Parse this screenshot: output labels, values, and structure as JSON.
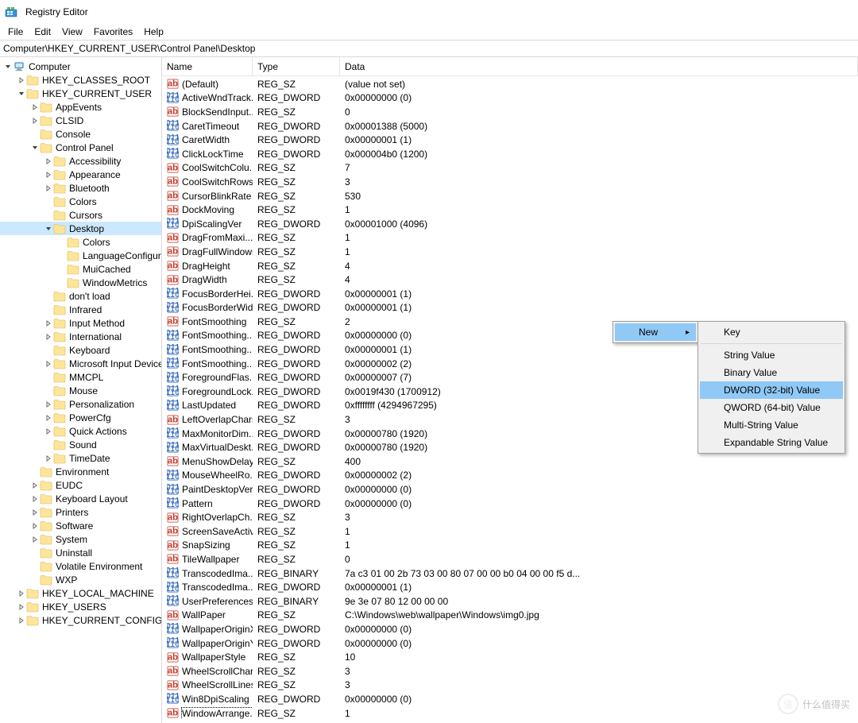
{
  "window": {
    "title": "Registry Editor"
  },
  "menu": {
    "file": "File",
    "edit": "Edit",
    "view": "View",
    "favorites": "Favorites",
    "help": "Help"
  },
  "address": {
    "path": "Computer\\HKEY_CURRENT_USER\\Control Panel\\Desktop"
  },
  "tree": [
    {
      "depth": 0,
      "exp": "open",
      "icon": "pc",
      "label": "Computer"
    },
    {
      "depth": 1,
      "exp": "closed",
      "icon": "folder",
      "label": "HKEY_CLASSES_ROOT"
    },
    {
      "depth": 1,
      "exp": "open",
      "icon": "folder",
      "label": "HKEY_CURRENT_USER"
    },
    {
      "depth": 2,
      "exp": "closed",
      "icon": "folder",
      "label": "AppEvents"
    },
    {
      "depth": 2,
      "exp": "closed",
      "icon": "folder",
      "label": "CLSID"
    },
    {
      "depth": 2,
      "exp": "none",
      "icon": "folder",
      "label": "Console"
    },
    {
      "depth": 2,
      "exp": "open",
      "icon": "folder",
      "label": "Control Panel"
    },
    {
      "depth": 3,
      "exp": "closed",
      "icon": "folder",
      "label": "Accessibility"
    },
    {
      "depth": 3,
      "exp": "closed",
      "icon": "folder",
      "label": "Appearance"
    },
    {
      "depth": 3,
      "exp": "closed",
      "icon": "folder",
      "label": "Bluetooth"
    },
    {
      "depth": 3,
      "exp": "none",
      "icon": "folder",
      "label": "Colors"
    },
    {
      "depth": 3,
      "exp": "none",
      "icon": "folder",
      "label": "Cursors"
    },
    {
      "depth": 3,
      "exp": "open",
      "icon": "folder",
      "label": "Desktop",
      "sel": true
    },
    {
      "depth": 4,
      "exp": "none",
      "icon": "folder",
      "label": "Colors"
    },
    {
      "depth": 4,
      "exp": "none",
      "icon": "folder",
      "label": "LanguageConfigurat"
    },
    {
      "depth": 4,
      "exp": "none",
      "icon": "folder",
      "label": "MuiCached"
    },
    {
      "depth": 4,
      "exp": "none",
      "icon": "folder",
      "label": "WindowMetrics"
    },
    {
      "depth": 3,
      "exp": "none",
      "icon": "folder",
      "label": "don't load"
    },
    {
      "depth": 3,
      "exp": "none",
      "icon": "folder",
      "label": "Infrared"
    },
    {
      "depth": 3,
      "exp": "closed",
      "icon": "folder",
      "label": "Input Method"
    },
    {
      "depth": 3,
      "exp": "closed",
      "icon": "folder",
      "label": "International"
    },
    {
      "depth": 3,
      "exp": "none",
      "icon": "folder",
      "label": "Keyboard"
    },
    {
      "depth": 3,
      "exp": "closed",
      "icon": "folder",
      "label": "Microsoft Input Devices"
    },
    {
      "depth": 3,
      "exp": "none",
      "icon": "folder",
      "label": "MMCPL"
    },
    {
      "depth": 3,
      "exp": "none",
      "icon": "folder",
      "label": "Mouse"
    },
    {
      "depth": 3,
      "exp": "closed",
      "icon": "folder",
      "label": "Personalization"
    },
    {
      "depth": 3,
      "exp": "closed",
      "icon": "folder",
      "label": "PowerCfg"
    },
    {
      "depth": 3,
      "exp": "closed",
      "icon": "folder",
      "label": "Quick Actions"
    },
    {
      "depth": 3,
      "exp": "none",
      "icon": "folder",
      "label": "Sound"
    },
    {
      "depth": 3,
      "exp": "closed",
      "icon": "folder",
      "label": "TimeDate"
    },
    {
      "depth": 2,
      "exp": "none",
      "icon": "folder",
      "label": "Environment"
    },
    {
      "depth": 2,
      "exp": "closed",
      "icon": "folder",
      "label": "EUDC"
    },
    {
      "depth": 2,
      "exp": "closed",
      "icon": "folder",
      "label": "Keyboard Layout"
    },
    {
      "depth": 2,
      "exp": "closed",
      "icon": "folder",
      "label": "Printers"
    },
    {
      "depth": 2,
      "exp": "closed",
      "icon": "folder",
      "label": "Software"
    },
    {
      "depth": 2,
      "exp": "closed",
      "icon": "folder",
      "label": "System"
    },
    {
      "depth": 2,
      "exp": "none",
      "icon": "folder",
      "label": "Uninstall"
    },
    {
      "depth": 2,
      "exp": "none",
      "icon": "folder",
      "label": "Volatile Environment"
    },
    {
      "depth": 2,
      "exp": "none",
      "icon": "folder",
      "label": "WXP"
    },
    {
      "depth": 1,
      "exp": "closed",
      "icon": "folder",
      "label": "HKEY_LOCAL_MACHINE"
    },
    {
      "depth": 1,
      "exp": "closed",
      "icon": "folder",
      "label": "HKEY_USERS"
    },
    {
      "depth": 1,
      "exp": "closed",
      "icon": "folder",
      "label": "HKEY_CURRENT_CONFIG"
    }
  ],
  "columns": {
    "name": "Name",
    "type": "Type",
    "data": "Data"
  },
  "values": [
    {
      "icon": "sz",
      "name": "(Default)",
      "type": "REG_SZ",
      "data": "(value not set)"
    },
    {
      "icon": "bin",
      "name": "ActiveWndTrack...",
      "type": "REG_DWORD",
      "data": "0x00000000 (0)"
    },
    {
      "icon": "sz",
      "name": "BlockSendInput...",
      "type": "REG_SZ",
      "data": "0"
    },
    {
      "icon": "bin",
      "name": "CaretTimeout",
      "type": "REG_DWORD",
      "data": "0x00001388 (5000)"
    },
    {
      "icon": "bin",
      "name": "CaretWidth",
      "type": "REG_DWORD",
      "data": "0x00000001 (1)"
    },
    {
      "icon": "bin",
      "name": "ClickLockTime",
      "type": "REG_DWORD",
      "data": "0x000004b0 (1200)"
    },
    {
      "icon": "sz",
      "name": "CoolSwitchColu...",
      "type": "REG_SZ",
      "data": "7"
    },
    {
      "icon": "sz",
      "name": "CoolSwitchRows",
      "type": "REG_SZ",
      "data": "3"
    },
    {
      "icon": "sz",
      "name": "CursorBlinkRate",
      "type": "REG_SZ",
      "data": "530"
    },
    {
      "icon": "sz",
      "name": "DockMoving",
      "type": "REG_SZ",
      "data": "1"
    },
    {
      "icon": "bin",
      "name": "DpiScalingVer",
      "type": "REG_DWORD",
      "data": "0x00001000 (4096)"
    },
    {
      "icon": "sz",
      "name": "DragFromMaxi...",
      "type": "REG_SZ",
      "data": "1"
    },
    {
      "icon": "sz",
      "name": "DragFullWindows",
      "type": "REG_SZ",
      "data": "1"
    },
    {
      "icon": "sz",
      "name": "DragHeight",
      "type": "REG_SZ",
      "data": "4"
    },
    {
      "icon": "sz",
      "name": "DragWidth",
      "type": "REG_SZ",
      "data": "4"
    },
    {
      "icon": "bin",
      "name": "FocusBorderHei...",
      "type": "REG_DWORD",
      "data": "0x00000001 (1)"
    },
    {
      "icon": "bin",
      "name": "FocusBorderWid...",
      "type": "REG_DWORD",
      "data": "0x00000001 (1)"
    },
    {
      "icon": "sz",
      "name": "FontSmoothing",
      "type": "REG_SZ",
      "data": "2"
    },
    {
      "icon": "bin",
      "name": "FontSmoothing...",
      "type": "REG_DWORD",
      "data": "0x00000000 (0)"
    },
    {
      "icon": "bin",
      "name": "FontSmoothing...",
      "type": "REG_DWORD",
      "data": "0x00000001 (1)"
    },
    {
      "icon": "bin",
      "name": "FontSmoothing...",
      "type": "REG_DWORD",
      "data": "0x00000002 (2)"
    },
    {
      "icon": "bin",
      "name": "ForegroundFlas...",
      "type": "REG_DWORD",
      "data": "0x00000007 (7)"
    },
    {
      "icon": "bin",
      "name": "ForegroundLock...",
      "type": "REG_DWORD",
      "data": "0x0019f430 (1700912)"
    },
    {
      "icon": "bin",
      "name": "LastUpdated",
      "type": "REG_DWORD",
      "data": "0xffffffff (4294967295)"
    },
    {
      "icon": "sz",
      "name": "LeftOverlapChars",
      "type": "REG_SZ",
      "data": "3"
    },
    {
      "icon": "bin",
      "name": "MaxMonitorDim...",
      "type": "REG_DWORD",
      "data": "0x00000780 (1920)"
    },
    {
      "icon": "bin",
      "name": "MaxVirtualDeskt...",
      "type": "REG_DWORD",
      "data": "0x00000780 (1920)"
    },
    {
      "icon": "sz",
      "name": "MenuShowDelay",
      "type": "REG_SZ",
      "data": "400"
    },
    {
      "icon": "bin",
      "name": "MouseWheelRo...",
      "type": "REG_DWORD",
      "data": "0x00000002 (2)"
    },
    {
      "icon": "bin",
      "name": "PaintDesktopVer...",
      "type": "REG_DWORD",
      "data": "0x00000000 (0)"
    },
    {
      "icon": "bin",
      "name": "Pattern",
      "type": "REG_DWORD",
      "data": "0x00000000 (0)"
    },
    {
      "icon": "sz",
      "name": "RightOverlapCh...",
      "type": "REG_SZ",
      "data": "3"
    },
    {
      "icon": "sz",
      "name": "ScreenSaveActive",
      "type": "REG_SZ",
      "data": "1"
    },
    {
      "icon": "sz",
      "name": "SnapSizing",
      "type": "REG_SZ",
      "data": "1"
    },
    {
      "icon": "sz",
      "name": "TileWallpaper",
      "type": "REG_SZ",
      "data": "0"
    },
    {
      "icon": "bin",
      "name": "TranscodedIma...",
      "type": "REG_BINARY",
      "data": "7a c3 01 00 2b 73 03 00 80 07 00 00 b0 04 00 00 f5 d..."
    },
    {
      "icon": "bin",
      "name": "TranscodedIma...",
      "type": "REG_DWORD",
      "data": "0x00000001 (1)"
    },
    {
      "icon": "bin",
      "name": "UserPreferences...",
      "type": "REG_BINARY",
      "data": "9e 3e 07 80 12 00 00 00"
    },
    {
      "icon": "sz",
      "name": "WallPaper",
      "type": "REG_SZ",
      "data": "C:\\Windows\\web\\wallpaper\\Windows\\img0.jpg"
    },
    {
      "icon": "bin",
      "name": "WallpaperOriginX",
      "type": "REG_DWORD",
      "data": "0x00000000 (0)"
    },
    {
      "icon": "bin",
      "name": "WallpaperOriginY",
      "type": "REG_DWORD",
      "data": "0x00000000 (0)"
    },
    {
      "icon": "sz",
      "name": "WallpaperStyle",
      "type": "REG_SZ",
      "data": "10"
    },
    {
      "icon": "sz",
      "name": "WheelScrollChars",
      "type": "REG_SZ",
      "data": "3"
    },
    {
      "icon": "sz",
      "name": "WheelScrollLines",
      "type": "REG_SZ",
      "data": "3"
    },
    {
      "icon": "bin",
      "name": "Win8DpiScaling",
      "type": "REG_DWORD",
      "data": "0x00000000 (0)"
    },
    {
      "icon": "sz",
      "name": "WindowArrange...",
      "type": "REG_SZ",
      "data": "1",
      "sel": true
    }
  ],
  "context_menu": {
    "new": "New",
    "sub": {
      "key": "Key",
      "string": "String Value",
      "binary": "Binary Value",
      "dword": "DWORD (32-bit) Value",
      "qword": "QWORD (64-bit) Value",
      "multi": "Multi-String Value",
      "expand": "Expandable String Value"
    }
  },
  "watermark": {
    "text": "什么值得买"
  }
}
